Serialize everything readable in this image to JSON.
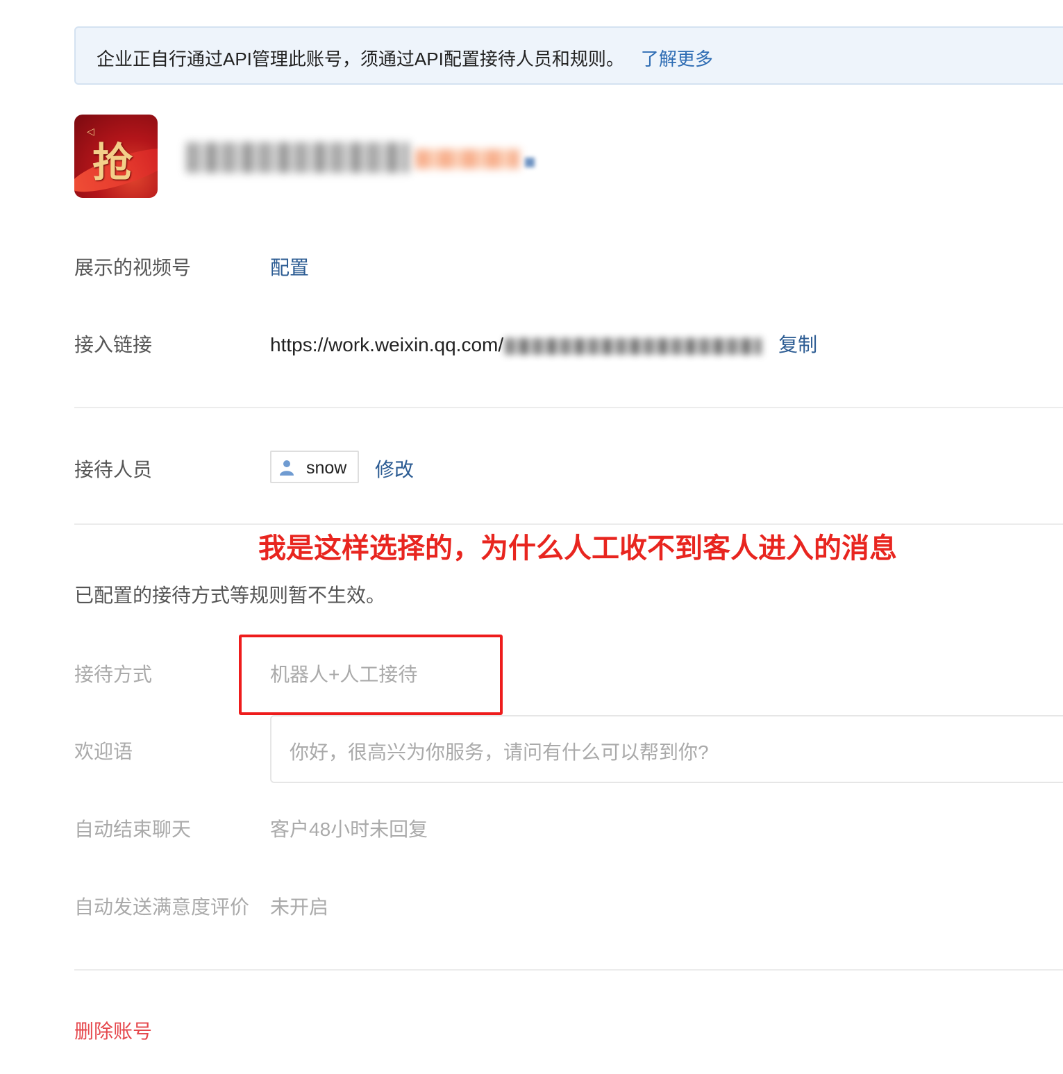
{
  "banner": {
    "text": "企业正自行通过API管理此账号，须通过API配置接待人员和规则。",
    "link": "了解更多"
  },
  "account": {
    "avatar_glyph": "抢"
  },
  "video_account": {
    "label": "展示的视频号",
    "action": "配置"
  },
  "access_link": {
    "label": "接入链接",
    "url_prefix": "https://work.weixin.qq.com/",
    "copy": "复制"
  },
  "agents": {
    "label": "接待人员",
    "name": "snow",
    "edit": "修改"
  },
  "annotation": "我是这样选择的，为什么人工收不到客人进入的消息",
  "notice": "已配置的接待方式等规则暂不生效。",
  "rules": {
    "mode": {
      "label": "接待方式",
      "value": "机器人+人工接待"
    },
    "welcome": {
      "label": "欢迎语",
      "value": "你好，很高兴为你服务，请问有什么可以帮到你?"
    },
    "auto_end": {
      "label": "自动结束聊天",
      "value": "客户48小时未回复"
    },
    "satisfaction": {
      "label": "自动发送满意度评价",
      "value": "未开启"
    }
  },
  "delete_account": "删除账号",
  "colors": {
    "link": "#2c5c93",
    "danger": "#e5484d",
    "annotation": "#e8251f",
    "banner_bg": "#eef4fb"
  }
}
